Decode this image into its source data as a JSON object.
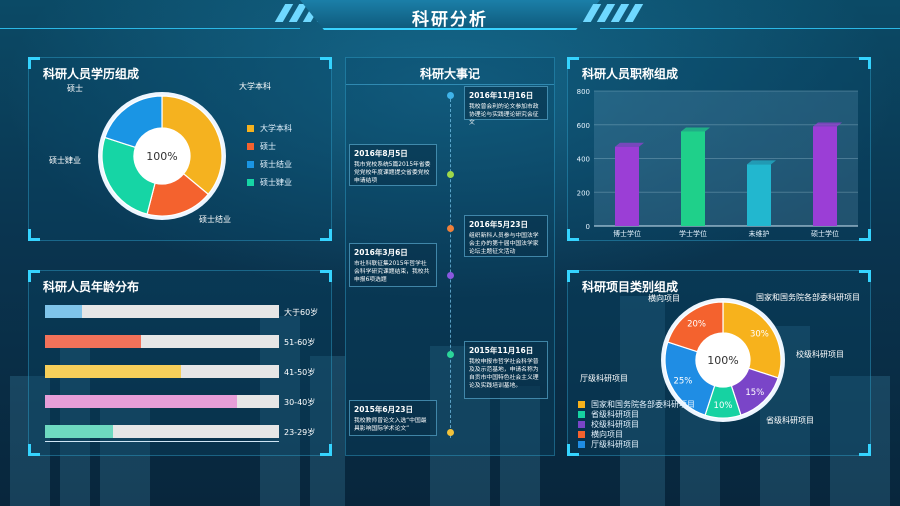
{
  "header": {
    "title": "科研分析"
  },
  "colors": {
    "accent": "#35d4ff",
    "bg": "#0a3550"
  },
  "education": {
    "title": "科研人员学历组成",
    "center": "100%",
    "legend": [
      "大学本科",
      "硕士",
      "硕士结业",
      "硕士肄业"
    ],
    "callouts": [
      "硕士",
      "大学本科",
      "硕士肄业",
      "硕士结业"
    ]
  },
  "age": {
    "title": "科研人员年龄分布",
    "rows": [
      {
        "label": "大于60岁",
        "pct": 16,
        "color": "#7fc4ea"
      },
      {
        "label": "51-60岁",
        "pct": 41,
        "color": "#f2725a"
      },
      {
        "label": "41-50岁",
        "pct": 58,
        "color": "#f6cf5a"
      },
      {
        "label": "30-40岁",
        "pct": 82,
        "color": "#e69ed8"
      },
      {
        "label": "23-29岁",
        "pct": 29,
        "color": "#6ed9c0"
      }
    ]
  },
  "events": {
    "title": "科研大事记",
    "items": [
      {
        "date": "2016年11月16日",
        "text": "我校曾会利的论文参加市政协理论与实践理论研究会征文"
      },
      {
        "date": "2016年8月5日",
        "text": "我市党校系统5篇2015年省委党党校年度课题提交省委党校申请结项"
      },
      {
        "date": "2016年5月23日",
        "text": "组织新科人员参与中国法学会主办的第十届中国法学家论坛主题征文活动"
      },
      {
        "date": "2016年3月6日",
        "text": "市社科联征集2015年哲学社会科学研究课题结束，我校共申报6项选题"
      },
      {
        "date": "2015年11月16日",
        "text": "我校申报市哲学社会科学普及及示范基地，申请名称为自贡市中国特色社会主义理论及实践培训基地。"
      },
      {
        "date": "2015年6月23日",
        "text": "我校教师曾论文入选“中国最具影响国际学术论文”"
      }
    ]
  },
  "titles": {
    "title": "科研人员职称组成",
    "yticks": [
      "800",
      "600",
      "400",
      "200",
      "0"
    ]
  },
  "projects": {
    "title": "科研项目类别组成",
    "center": "100%",
    "slice_labels": [
      "30%",
      "15%",
      "10%",
      "25%",
      "20%"
    ],
    "callouts": [
      "横向项目",
      "国家和国务院各部委科研项目",
      "校级科研项目",
      "厅级科研项目",
      "省级科研项目"
    ],
    "legend": [
      "国家和国务院各部委科研项目",
      "省级科研项目",
      "校级科研项目",
      "横向项目",
      "厅级科研项目"
    ]
  },
  "chart_data": [
    {
      "type": "pie",
      "title": "科研人员学历组成",
      "labels": [
        "大学本科",
        "硕士",
        "硕士结业",
        "硕士肄业"
      ],
      "values": [
        36,
        18,
        26,
        20
      ],
      "colors": [
        "#f5b21f",
        "#f4622e",
        "#16d5a5",
        "#1a95e4"
      ]
    },
    {
      "type": "bar",
      "title": "科研人员年龄分布",
      "categories": [
        "大于60岁",
        "51-60岁",
        "41-50岁",
        "30-40岁",
        "23-29岁"
      ],
      "values": [
        16,
        41,
        58,
        82,
        29
      ]
    },
    {
      "type": "bar",
      "title": "科研人员职称组成",
      "categories": [
        "博士学位",
        "学士学位",
        "未维护",
        "硕士学位"
      ],
      "values": [
        470,
        560,
        365,
        590
      ],
      "colors": [
        "#9b3ed6",
        "#1fd08a",
        "#22b7cf",
        "#9b3ed6"
      ],
      "ylim": [
        0,
        800
      ]
    },
    {
      "type": "pie",
      "title": "科研项目类别组成",
      "labels": [
        "国家和国务院各部委科研项目",
        "校级科研项目",
        "省级科研项目",
        "厅级科研项目",
        "横向项目"
      ],
      "values": [
        30,
        15,
        10,
        25,
        20
      ],
      "colors": [
        "#f7b21c",
        "#7a45c8",
        "#16d2a2",
        "#1f8de4",
        "#f4622e"
      ]
    }
  ]
}
